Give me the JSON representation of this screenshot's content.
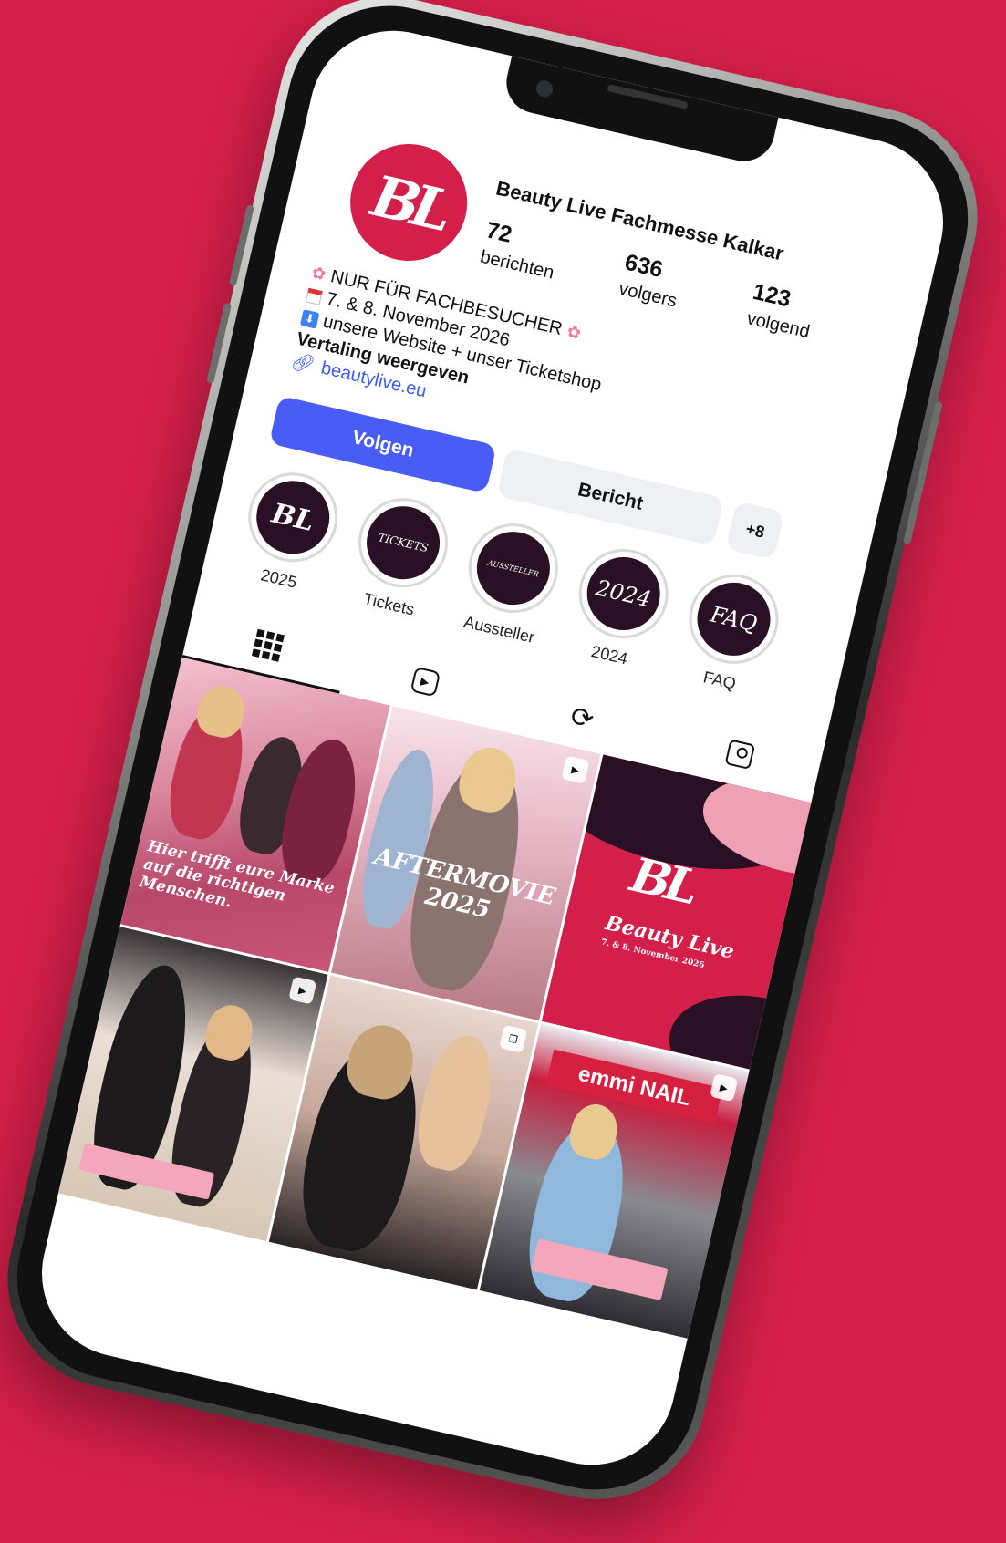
{
  "profile": {
    "name": "Beauty Live Fachmesse Kalkar",
    "avatar_monogram": "BL",
    "stats": [
      {
        "num": "72",
        "label": "berichten"
      },
      {
        "num": "636",
        "label": "volgers"
      },
      {
        "num": "123",
        "label": "volgend"
      }
    ],
    "bio": {
      "line1": "NUR FÜR FACHBESUCHER",
      "line2": "7. & 8. November 2026",
      "line3": "unsere Website + unser Ticketshop",
      "translation": "Vertaling weergeven",
      "link": "beautylive.eu"
    }
  },
  "actions": {
    "follow_label": "Volgen",
    "message_label": "Bericht",
    "add_label": "+8"
  },
  "highlights": [
    {
      "label": "2025",
      "cover": "BL"
    },
    {
      "label": "Tickets",
      "cover": "TICKETS"
    },
    {
      "label": "Aussteller",
      "cover": "AUSSTELLER"
    },
    {
      "label": "2024",
      "cover": "2024"
    },
    {
      "label": "FAQ",
      "cover": "FAQ"
    }
  ],
  "tabs": [
    "grid-icon",
    "reels-icon",
    "repost-icon",
    "tagged-icon"
  ],
  "posts": [
    {
      "caption": "Hier trifft eure Marke auf die richtigen Menschen."
    },
    {
      "caption": "AFTERMOVIE 2025"
    },
    {
      "caption": "Beauty Live",
      "subcaption": "7. & 8. November 2026"
    },
    {
      "tag": ""
    },
    {
      "tag": ""
    },
    {
      "brand": "emmi NAIL"
    }
  ],
  "colors": {
    "background": "#d41f4a",
    "brand": "#d41f4a",
    "follow_button": "#4a5cf6",
    "highlight_bg": "#2a1024"
  }
}
